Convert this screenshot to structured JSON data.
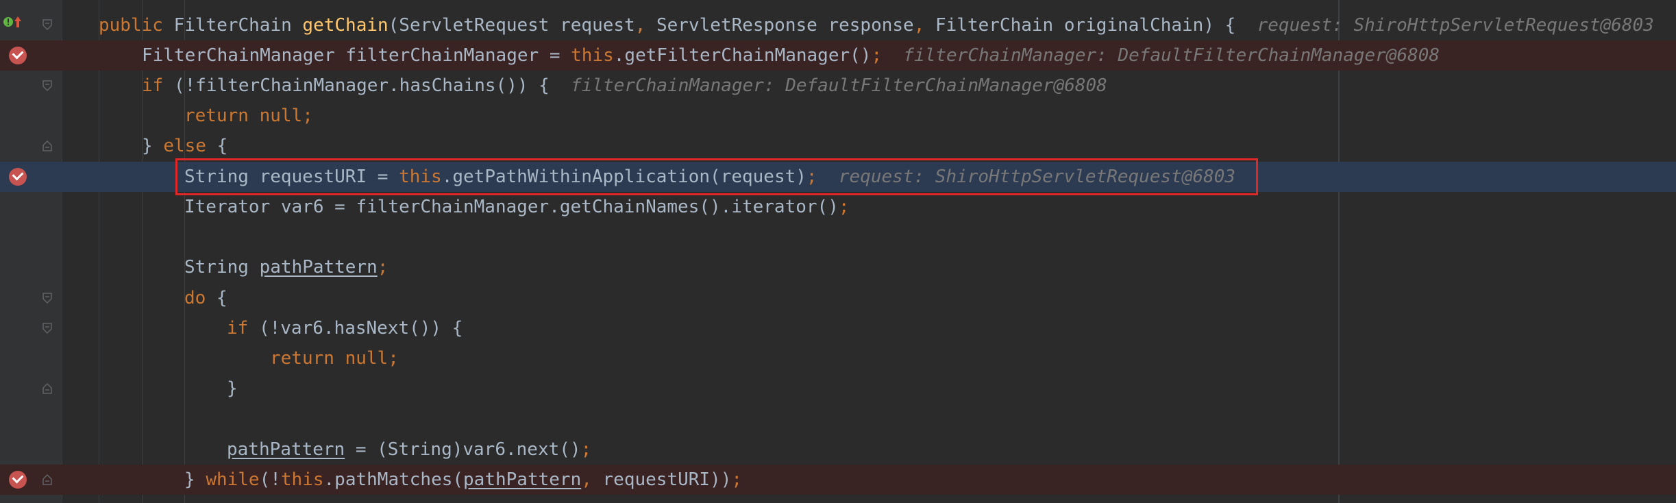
{
  "colors": {
    "background": "#2b2b2b",
    "keyword": "#cc7832",
    "method_declaration": "#ffc66d",
    "default_text": "#a9b7c6",
    "inline_hint": "#787878",
    "breakpoint": "#c75450",
    "highlight_border": "#e02828",
    "execution_line": "#2d3b52",
    "breakpoint_line": "#3a2323"
  },
  "gutter_icons": [
    "override-method-icon",
    "breakpoint-icon",
    "fold-icon"
  ],
  "lines": {
    "l1": {
      "public": "public",
      "type": "FilterChain",
      "method": "getChain",
      "p1": "(ServletRequest request",
      "comma1": ",",
      "p2": " ServletResponse response",
      "comma2": ",",
      "p3": " FilterChain originalChain) {",
      "hint": "request: ShiroHttpServletRequest@6803"
    },
    "l2": {
      "pre": "FilterChainManager filterChainManager = ",
      "this": "this",
      "post": ".getFilterChainManager()",
      "semi": ";",
      "hint": "filterChainManager: DefaultFilterChainManager@6808"
    },
    "l3": {
      "if": "if",
      "post": " (!filterChainManager.hasChains()) {",
      "hint": "filterChainManager: DefaultFilterChainManager@6808"
    },
    "l4": {
      "return": "return",
      "null": "null",
      "semi": ";"
    },
    "l5": {
      "brace": "} ",
      "else": "else",
      "post": " {"
    },
    "l6": {
      "pre": "String requestURI = ",
      "this": "this",
      "post": ".getPathWithinApplication(request)",
      "semi": ";",
      "hint": "request: ShiroHttpServletRequest@6803"
    },
    "l7": {
      "pre": "Iterator var6 = filterChainManager.getChainNames().iterator()",
      "semi": ";"
    },
    "l9": {
      "pre": "String ",
      "var": "pathPattern",
      "semi": ";"
    },
    "l10": {
      "do": "do",
      "post": " {"
    },
    "l11": {
      "if": "if",
      "post": " (!var6.hasNext()) {"
    },
    "l12": {
      "return": "return",
      "null": "null",
      "semi": ";"
    },
    "l13": {
      "brace": "}"
    },
    "l15": {
      "var": "pathPattern",
      "post": " = (String)var6.next()",
      "semi": ";"
    },
    "l16": {
      "brace": "} ",
      "while": "while",
      "paren": "(!",
      "this": "this",
      "post": ".pathMatches(",
      "var": "pathPattern",
      "comma": ",",
      "tail": " requestURI))",
      "semi": ";"
    }
  }
}
